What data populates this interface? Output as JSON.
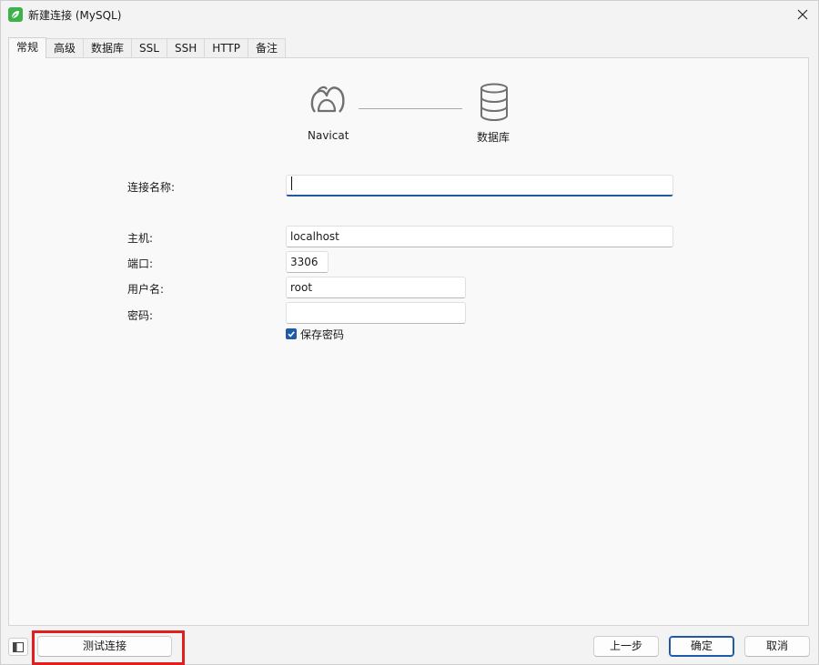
{
  "window": {
    "title": "新建连接 (MySQL)"
  },
  "tabs": [
    {
      "label": "常规",
      "active": true
    },
    {
      "label": "高级"
    },
    {
      "label": "数据库"
    },
    {
      "label": "SSL"
    },
    {
      "label": "SSH"
    },
    {
      "label": "HTTP"
    },
    {
      "label": "备注"
    }
  ],
  "diagram": {
    "left_label": "Navicat",
    "right_label": "数据库"
  },
  "form": {
    "connection_name_label": "连接名称:",
    "connection_name_value": "",
    "host_label": "主机:",
    "host_value": "localhost",
    "port_label": "端口:",
    "port_value": "3306",
    "username_label": "用户名:",
    "username_value": "root",
    "password_label": "密码:",
    "password_value": "",
    "save_password_label": "保存密码",
    "save_password_checked": true
  },
  "footer": {
    "test_button": "测试连接",
    "back_button": "上一步",
    "ok_button": "确定",
    "cancel_button": "取消"
  },
  "colors": {
    "accent": "#1e5aa8",
    "highlight": "#e02020",
    "app_icon": "#3db24b"
  }
}
